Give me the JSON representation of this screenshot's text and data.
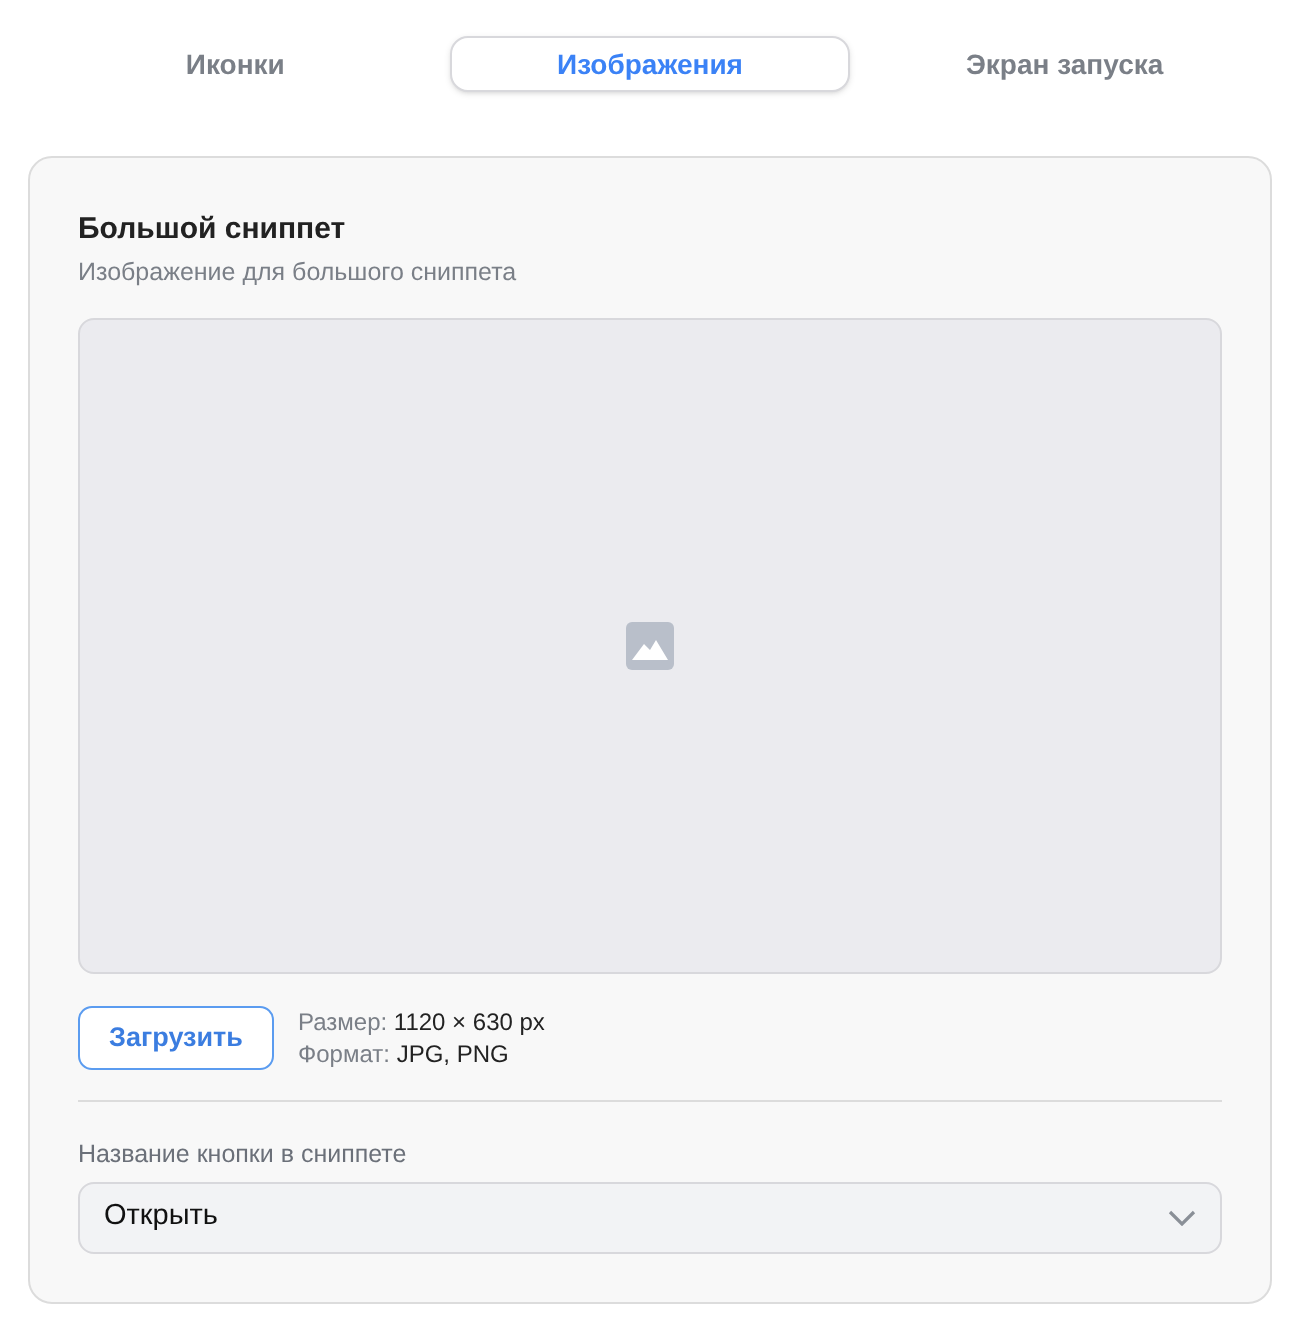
{
  "tabs": [
    {
      "label": "Иконки",
      "selected": false
    },
    {
      "label": "Изображения",
      "selected": true
    },
    {
      "label": "Экран запуска",
      "selected": false
    }
  ],
  "section": {
    "title": "Большой сниппет",
    "subtitle": "Изображение для большого сниппета",
    "image": {
      "kind": "empty"
    },
    "upload_button": "Загрузить",
    "specs": [
      {
        "label": "Размер:",
        "value": "1120 × 630 px"
      },
      {
        "label": "Формат:",
        "value": "JPG, PNG"
      }
    ],
    "select": {
      "label": "Название кнопки в сниппете",
      "value": "Открыть"
    }
  }
}
